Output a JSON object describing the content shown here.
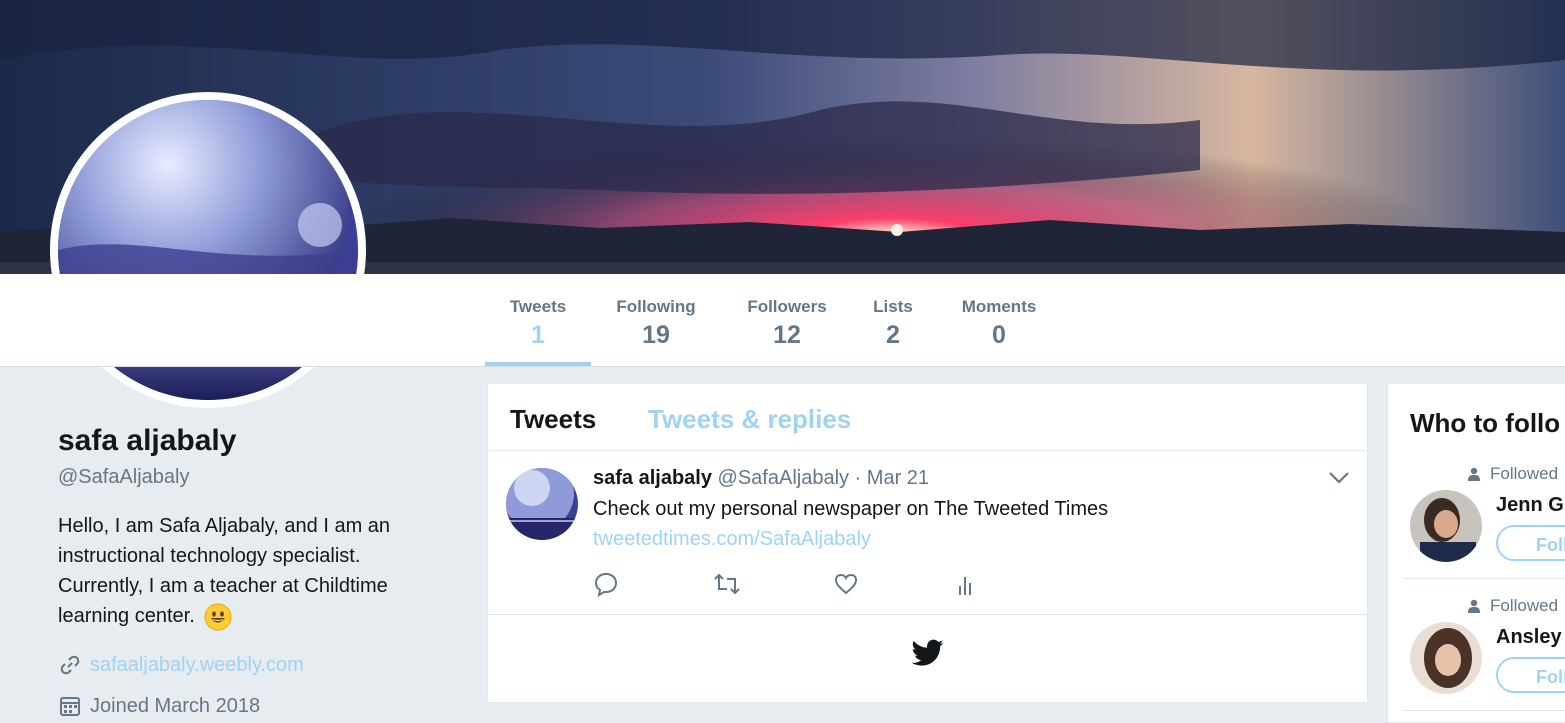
{
  "profile": {
    "name": "safa aljabaly",
    "handle": "@SafaAljabaly",
    "bio": "Hello, I am Safa Aljabaly, and I am an instructional technology specialist. Currently, I am a teacher at Childtime learning center.",
    "website": "safaaljabaly.weebly.com",
    "joined": "Joined March 2018",
    "website_icon": "link-icon",
    "joined_icon": "calendar-icon"
  },
  "stats": [
    {
      "label": "Tweets",
      "value": "1"
    },
    {
      "label": "Following",
      "value": "19"
    },
    {
      "label": "Followers",
      "value": "12"
    },
    {
      "label": "Lists",
      "value": "2"
    },
    {
      "label": "Moments",
      "value": "0"
    }
  ],
  "timeline": {
    "tabs": [
      "Tweets",
      "Tweets & replies"
    ],
    "tweet": {
      "name": "safa aljabaly",
      "handle": "@SafaAljabaly",
      "date": "· Mar 21",
      "text": "Check out my personal newspaper on The Tweeted Times",
      "link": "tweetedtimes.com/SafaAljabaly"
    }
  },
  "who_to_follow": {
    "title": "Who to follo",
    "items": [
      {
        "context": "Followed",
        "name": "Jenn G",
        "button": "Foll"
      },
      {
        "context": "Followed",
        "name": "Ansley",
        "button": "Foll"
      }
    ]
  },
  "colors": {
    "accent": "#9fd3f2",
    "muted": "#657786",
    "text": "#14171a",
    "background": "#e6ecf0"
  }
}
